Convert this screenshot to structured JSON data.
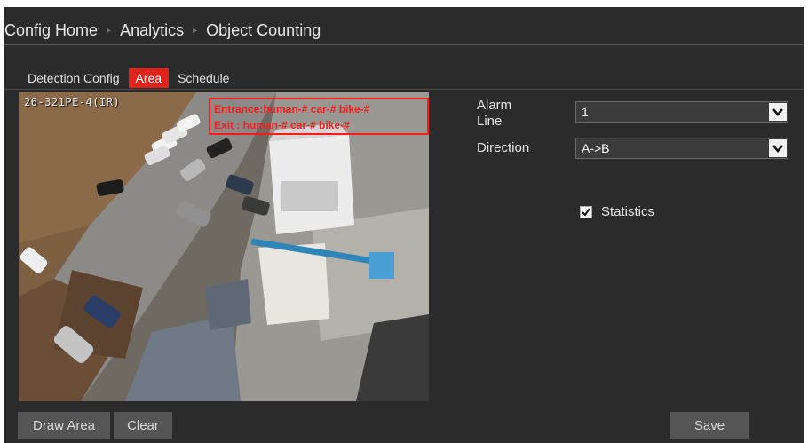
{
  "breadcrumb": {
    "items": [
      "Config Home",
      "Analytics",
      "Object Counting"
    ]
  },
  "tabs": [
    {
      "label": "Detection Config",
      "active": false
    },
    {
      "label": "Area",
      "active": true
    },
    {
      "label": "Schedule",
      "active": false
    }
  ],
  "video": {
    "osd_time": "26-321PE-4(IR)",
    "count_lines": [
      "Entrance:human-# car-# bike-#",
      "Exit    : human-# car-# bike-#"
    ]
  },
  "form": {
    "alarm_line_label": "Alarm Line",
    "alarm_line_value": "1",
    "direction_label": "Direction",
    "direction_value": "A->B",
    "statistics_label": "Statistics",
    "statistics_checked": true
  },
  "buttons": {
    "draw_area": "Draw Area",
    "clear": "Clear",
    "save": "Save"
  },
  "colors": {
    "accent": "#e0241b",
    "panel_bg": "#2b2b2b",
    "button_bg": "#555555",
    "counter_text": "#ff1a1a"
  }
}
